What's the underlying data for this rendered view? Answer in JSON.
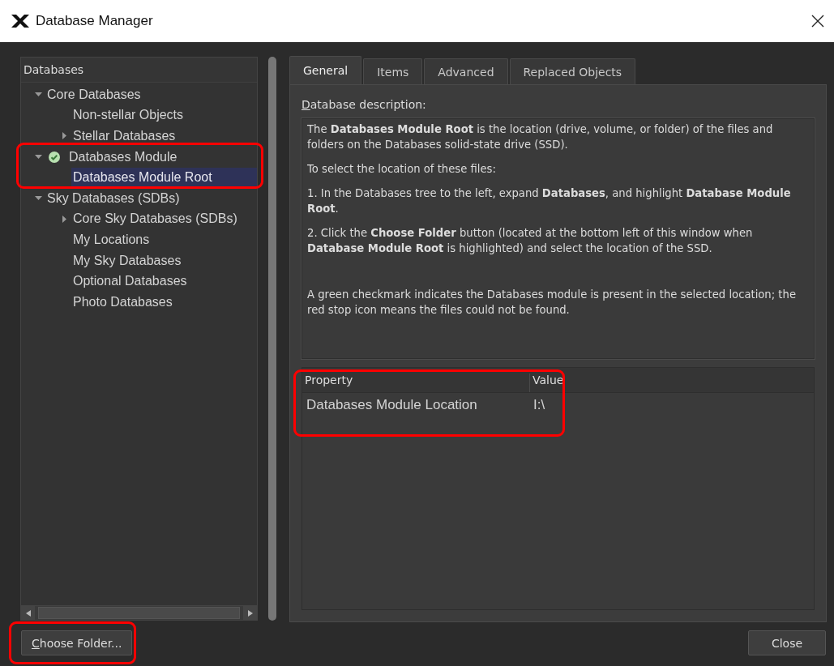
{
  "window": {
    "title": "Database Manager"
  },
  "tree": {
    "header": "Databases",
    "items": [
      {
        "label": "Core Databases",
        "expanded": true,
        "children": [
          {
            "label": "Non-stellar Objects"
          },
          {
            "label": "Stellar Databases",
            "expanded": false
          }
        ]
      },
      {
        "label": "Databases Module",
        "expanded": true,
        "present": true,
        "children": [
          {
            "label": "Databases Module Root",
            "selected": true
          }
        ]
      },
      {
        "label": "Sky Databases (SDBs)",
        "expanded": true,
        "children": [
          {
            "label": "Core Sky Databases (SDBs)",
            "expanded": false
          },
          {
            "label": "My Locations"
          },
          {
            "label": "My Sky Databases"
          },
          {
            "label": "Optional Databases"
          },
          {
            "label": "Photo Databases"
          }
        ]
      }
    ]
  },
  "tabs": [
    {
      "label": "General",
      "selected": true
    },
    {
      "label": "Items",
      "selected": false
    },
    {
      "label": "Advanced",
      "selected": false
    },
    {
      "label": "Replaced Objects",
      "selected": false
    }
  ],
  "description": {
    "label": "Database description:",
    "mnemonic": true,
    "paragraphs": [
      "The **Databases Module Root** is the location (drive, volume, or folder) of the files and folders on the Databases solid-state drive (SSD).",
      "To select the location of these files:",
      "1. In the Databases tree to the left, expand **Databases**, and highlight **Database Module Root**.",
      "2. Click the **Choose Folder** button (located at the bottom left of this window when **Database Module Root** is highlighted) and select the location of the SSD.",
      "A green checkmark indicates the Databases module is present in the selected location; the red stop icon means the files could not be found."
    ]
  },
  "table": {
    "columns": [
      "Property",
      "Value"
    ],
    "rows": [
      [
        "Databases Module Location",
        "I:\\"
      ]
    ]
  },
  "buttons": [
    {
      "label": "Choose Folder...",
      "mnemonic": true
    },
    {
      "label": "Close",
      "mnemonic": false
    }
  ]
}
